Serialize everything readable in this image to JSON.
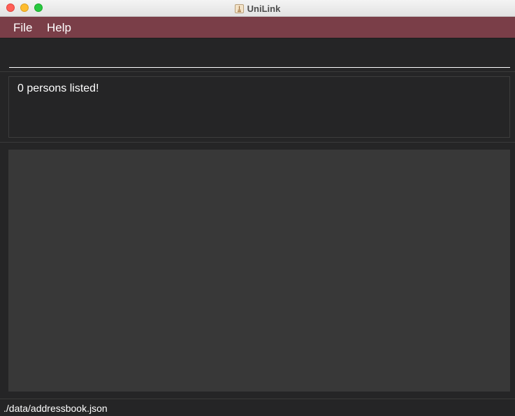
{
  "window": {
    "title": "UniLink",
    "controls": [
      "close",
      "minimize",
      "maximize"
    ],
    "app_icon": "java-app-icon"
  },
  "menubar": {
    "items": [
      {
        "label": "File"
      },
      {
        "label": "Help"
      }
    ],
    "color": "#7a3e48"
  },
  "command_box": {
    "value": "",
    "placeholder": ""
  },
  "result_display": {
    "text": "0 persons listed!"
  },
  "person_list": {
    "items": []
  },
  "status_bar": {
    "file_path": "./data/addressbook.json"
  },
  "colors": {
    "background": "#252526",
    "list_background": "#383838",
    "accent": "#7a3e48"
  }
}
